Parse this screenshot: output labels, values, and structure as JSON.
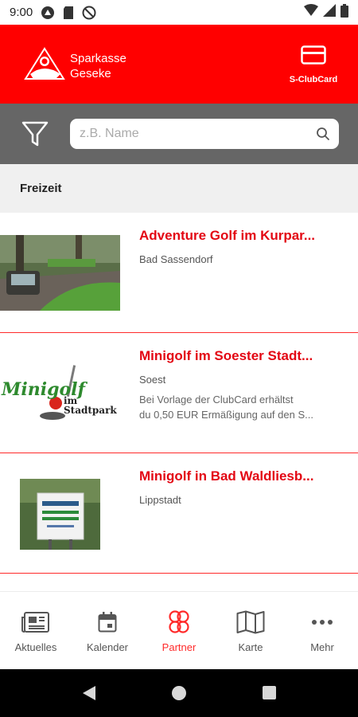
{
  "status_bar": {
    "time": "9:00"
  },
  "header": {
    "brand_line1": "Sparkasse",
    "brand_line2": "Geseke",
    "clubcard_label": "S-ClubCard",
    "color": "#ff0000"
  },
  "search": {
    "placeholder": "z.B. Name",
    "value": ""
  },
  "section": {
    "title": "Freizeit"
  },
  "list": [
    {
      "title": "Adventure Golf im Kurpar...",
      "location": "Bad Sassendorf",
      "desc_line1": "",
      "desc_line2": ""
    },
    {
      "title": "Minigolf im Soester Stadt...",
      "location": "Soest",
      "desc_line1": "Bei Vorlage der ClubCard erhältst",
      "desc_line2": "du 0,50 EUR Ermäßigung auf den S...",
      "logo_text1": "Minigolf",
      "logo_text2": "im",
      "logo_text3": "Stadtpark"
    },
    {
      "title": "Minigolf in Bad Waldliesb...",
      "location": "Lippstadt",
      "desc_line1": "",
      "desc_line2": ""
    }
  ],
  "bottom_nav": [
    {
      "label": "Aktuelles",
      "icon": "newspaper-icon",
      "active": false
    },
    {
      "label": "Kalender",
      "icon": "calendar-icon",
      "active": false
    },
    {
      "label": "Partner",
      "icon": "partner-icon",
      "active": true
    },
    {
      "label": "Karte",
      "icon": "map-icon",
      "active": false
    },
    {
      "label": "Mehr",
      "icon": "more-icon",
      "active": false
    }
  ],
  "colors": {
    "accent": "#e30613",
    "header": "#ff0000",
    "searchbar": "#666666",
    "section": "#f0f0f0"
  }
}
